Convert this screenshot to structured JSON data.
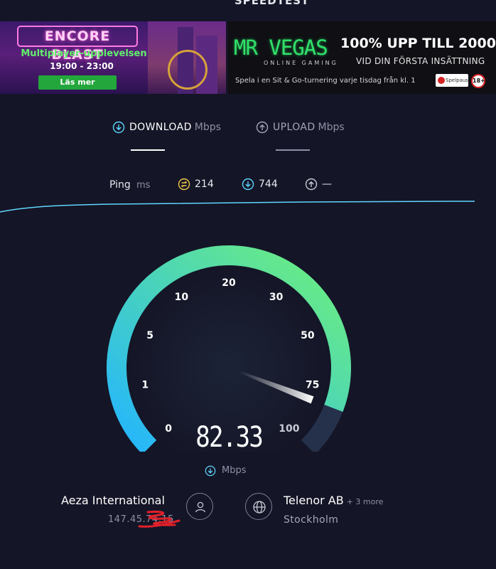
{
  "header": {
    "brand": "SPEEDTEST"
  },
  "ads": {
    "left": {
      "logo": "ENCORE BLAST",
      "tagline": "Multiplayer-upplevelsen",
      "time": "19:00 - 23:00",
      "cta": "Läs mer",
      "accent": "#5ff06a"
    },
    "right": {
      "logo": "MR VEGAS",
      "logo_sub": "ONLINE GAMING",
      "offer": "100% UPP TILL 2000",
      "offer_sub": "VID DIN FÖRSTA INSÄTTNING",
      "promo": "Spela i en Sit & Go-turnering varje tisdag från kl. 1",
      "spelpaus": "Spelpaus",
      "age": "18+",
      "accent": "#31e06b"
    }
  },
  "tabs": [
    {
      "label": "DOWNLOAD",
      "unit": "Mbps",
      "icon": "download-icon",
      "active": true
    },
    {
      "label": "UPLOAD",
      "unit": "Mbps",
      "icon": "upload-icon",
      "active": false
    }
  ],
  "ping": {
    "label": "Ping",
    "unit": "ms",
    "idle": {
      "icon": "ping-idle-icon",
      "value": "214"
    },
    "download": {
      "icon": "download-latency-icon",
      "value": "744"
    },
    "upload": {
      "icon": "upload-latency-icon",
      "value": "—"
    }
  },
  "gauge": {
    "ticks": [
      "0",
      "1",
      "5",
      "10",
      "20",
      "30",
      "50",
      "75",
      "100"
    ],
    "needle_value": 82.33,
    "reading": "82.33",
    "unit": "Mbps",
    "unit_icon": "download-icon",
    "colors": {
      "start": "#23b5ff",
      "end": "#6ff07a",
      "track": "#25304a",
      "needle": "#ffffff"
    }
  },
  "provider": {
    "name": "Aeza International",
    "ip": "147.45.74.15",
    "icon": "user-icon"
  },
  "server": {
    "name": "Telenor AB",
    "more": "+ 3 more",
    "location": "Stockholm",
    "icon": "globe-icon"
  }
}
